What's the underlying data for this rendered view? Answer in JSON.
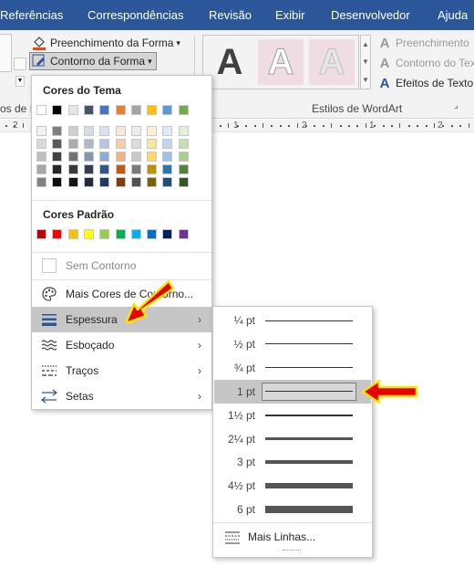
{
  "tabs": [
    "Referências",
    "Correspondências",
    "Revisão",
    "Exibir",
    "Desenvolvedor",
    "Ajuda"
  ],
  "ribbon": {
    "shape_fill": "Preenchimento da Forma",
    "shape_outline": "Contorno da Forma",
    "text_fill": "Preenchimento",
    "text_outline": "Contorno do Tex",
    "text_effects": "Efeitos de Texto",
    "group_shape_styles": "os de F",
    "group_wordart": "Estilos de WordArt",
    "wordart_letter": "A"
  },
  "ruler": {
    "numbers": [
      "2",
      "1",
      "2",
      "1",
      "2",
      "3"
    ]
  },
  "menu": {
    "theme_colors_title": "Cores do Tema",
    "standard_colors_title": "Cores Padrão",
    "no_outline": "Sem Contorno",
    "more_colors": "Mais Cores de Contorno...",
    "weight": "Espessura",
    "sketched": "Esboçado",
    "dashes": "Traços",
    "arrows": "Setas",
    "theme_colors": [
      [
        "#ffffff",
        "#f2f2f2",
        "#d9d9d9",
        "#bfbfbf",
        "#a6a6a6",
        "#808080"
      ],
      [
        "#000000",
        "#808080",
        "#595959",
        "#404040",
        "#262626",
        "#0d0d0d"
      ],
      [
        "#e7e6e6",
        "#d0cece",
        "#aeabab",
        "#757171",
        "#3a3838",
        "#171616"
      ],
      [
        "#44546a",
        "#d6dce4",
        "#adb9ca",
        "#8497b0",
        "#333f4f",
        "#222a35"
      ],
      [
        "#4472c4",
        "#d9e2f3",
        "#b4c6e7",
        "#8eaadb",
        "#2f5496",
        "#1f3864"
      ],
      [
        "#ed7d31",
        "#fbe5d5",
        "#f7cbac",
        "#f4b183",
        "#c55a11",
        "#833c0b"
      ],
      [
        "#a5a5a5",
        "#ededed",
        "#dbdbdb",
        "#c9c9c9",
        "#7b7b7b",
        "#525252"
      ],
      [
        "#ffc000",
        "#fff2cc",
        "#ffe598",
        "#ffd965",
        "#bf9000",
        "#7f6000"
      ],
      [
        "#5b9bd5",
        "#deebf6",
        "#bdd7ee",
        "#9cc3e5",
        "#2e75b5",
        "#1e4e79"
      ],
      [
        "#70ad47",
        "#e2efd9",
        "#c5e0b3",
        "#a8d08d",
        "#538135",
        "#375623"
      ]
    ],
    "standard_colors": [
      "#c00000",
      "#ff0000",
      "#ffc000",
      "#ffff00",
      "#92d050",
      "#00b050",
      "#00b0f0",
      "#0070c0",
      "#002060",
      "#7030a0"
    ]
  },
  "weights": {
    "items": [
      {
        "label": "¼ pt",
        "value": 0.25
      },
      {
        "label": "½ pt",
        "value": 0.5
      },
      {
        "label": "¾ pt",
        "value": 0.75
      },
      {
        "label": "1 pt",
        "value": 1,
        "selected": true
      },
      {
        "label": "1½ pt",
        "value": 1.5
      },
      {
        "label": "2¼ pt",
        "value": 2.25
      },
      {
        "label": "3 pt",
        "value": 3
      },
      {
        "label": "4½ pt",
        "value": 4.5
      },
      {
        "label": "6 pt",
        "value": 6
      }
    ],
    "more_lines": "Mais Linhas..."
  },
  "colors": {
    "tab_bar": "#2b579a",
    "highlight": "#c6c6c6",
    "callout_arrow": "#e60000",
    "callout_outline": "#ffe600",
    "wordart_style1": "#404040",
    "wordart_style2": "#a0a0a0",
    "wordart_style3": "#c8c8c8"
  }
}
